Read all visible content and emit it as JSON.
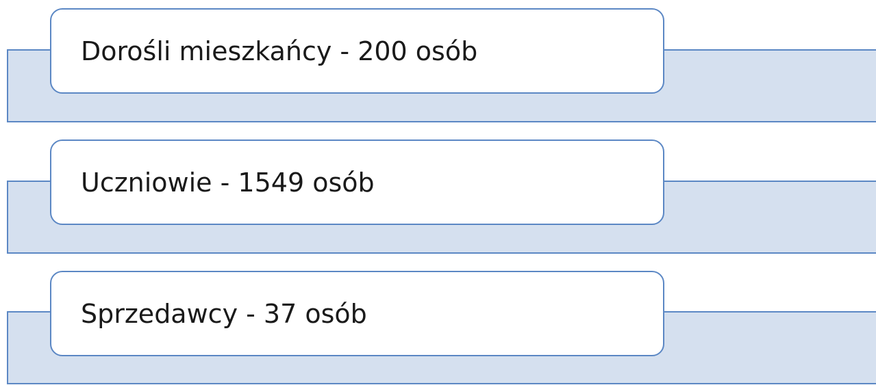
{
  "items": [
    {
      "label": "Dorośli mieszkańcy - 200 osób"
    },
    {
      "label": "Uczniowie - 1549 osób"
    },
    {
      "label": "Sprzedawcy - 37 osób"
    }
  ],
  "colors": {
    "band_fill": "#d5e0ef",
    "border": "#5b87c4",
    "card_fill": "#ffffff",
    "text": "#1a1a1a"
  }
}
